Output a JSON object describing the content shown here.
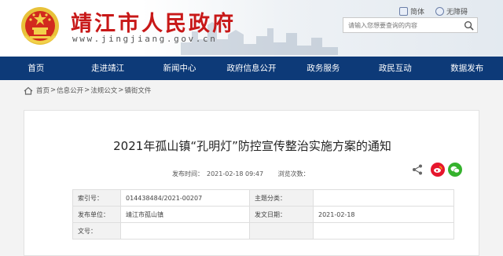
{
  "header": {
    "site_title": "靖江市人民政府",
    "site_url": "www.jingjiang.gov.cn",
    "links": [
      {
        "label": "简体",
        "icon": "simplified-chinese-icon"
      },
      {
        "label": "无障碍",
        "icon": "accessibility-icon"
      }
    ],
    "search_placeholder": "请输入您想要查询的内容",
    "colors": {
      "title": "#c81818",
      "nav": "#0d3a78"
    }
  },
  "nav": {
    "items": [
      "首页",
      "走进靖江",
      "新闻中心",
      "政府信息公开",
      "政务服务",
      "政民互动",
      "数据发布"
    ]
  },
  "breadcrumb": {
    "items": [
      "首页",
      "信息公开",
      "法规公文",
      "镇街文件"
    ],
    "separator": ">"
  },
  "article": {
    "title": "2021年孤山镇“孔明灯”防控宣传整治实施方案的通知",
    "publish_label": "发布时间：",
    "publish_time": "2021-02-18 09:47",
    "views_label": "浏览次数：",
    "views_value": ""
  },
  "info_table": {
    "rows": [
      {
        "label1": "索引号：",
        "value1": "014438484/2021-00207",
        "label2": "主题分类：",
        "value2": ""
      },
      {
        "label1": "发布单位：",
        "value1": "靖江市孤山镇",
        "label2": "发文日期：",
        "value2": "2021-02-18"
      },
      {
        "label1": "文号：",
        "value1": "",
        "label2": "",
        "value2": ""
      }
    ]
  }
}
